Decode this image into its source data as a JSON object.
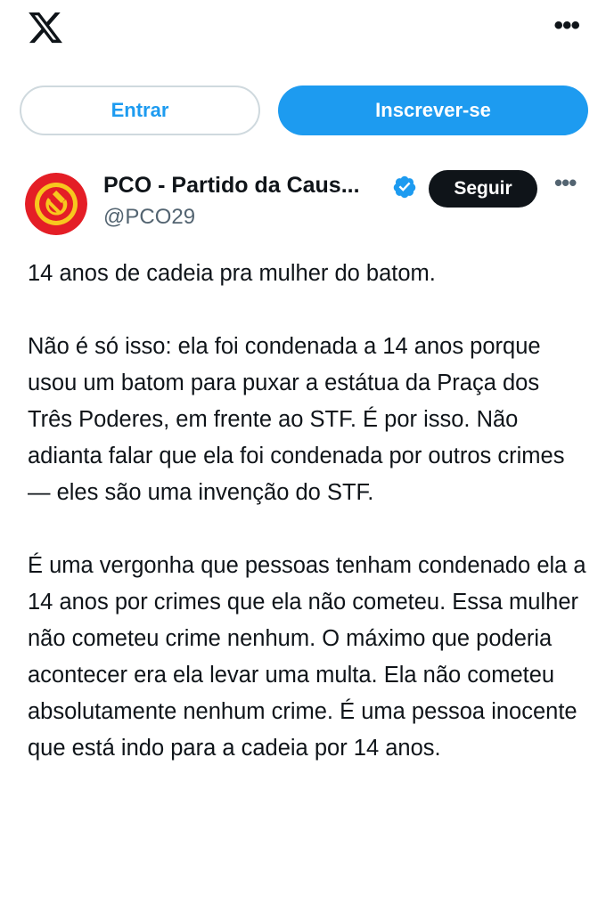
{
  "topbar": {
    "logo_icon": "x-logo-icon",
    "more_icon": "more-horizontal-icon",
    "more_glyph": "•••"
  },
  "auth": {
    "login_label": "Entrar",
    "signup_label": "Inscrever-se"
  },
  "tweet": {
    "author": {
      "display_name": "PCO - Partido da Caus...",
      "handle": "@PCO29",
      "verified": true,
      "avatar_icon": "hammer-sickle-icon"
    },
    "follow_label": "Seguir",
    "more_glyph": "•••",
    "paragraphs": [
      "14 anos de cadeia pra mulher do batom.",
      "Não é só isso: ela foi condenada a 14 anos porque usou um batom para puxar a estátua da Praça dos Três Poderes, em frente ao STF. É por isso. Não adianta falar que ela foi condenada por outros crimes — eles são uma invenção do STF.",
      "É uma vergonha que pessoas tenham condenado ela a 14 anos por crimes que ela não cometeu. Essa mulher não cometeu crime nenhum. O máximo que poderia acontecer era ela levar uma multa. Ela não cometeu absolutamente nenhum crime. É uma pessoa inocente que está indo para a cadeia por 14 anos."
    ]
  },
  "colors": {
    "accent": "#1d9bf0",
    "text": "#0f1419",
    "secondary": "#536471",
    "avatar_red": "#e41e26",
    "avatar_yellow": "#f7c81e"
  }
}
